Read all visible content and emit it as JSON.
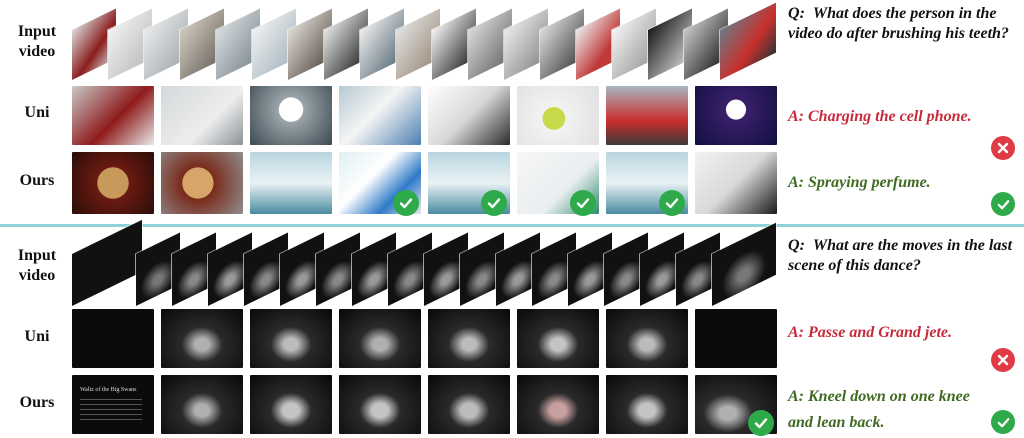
{
  "labels": {
    "input": "Input\nvideo",
    "uni": "Uni",
    "ours": "Ours"
  },
  "example1": {
    "question_prefix": "Q",
    "question": "What does the person in the video do after brushing his teeth?",
    "uni_answer": "A: Charging the cell phone.",
    "ours_answer": "A: Spraying perfume."
  },
  "example2": {
    "question_prefix": "Q",
    "question": "What are the moves in the last scene of this dance?",
    "uni_answer": "A: Passe and Grand jete.",
    "ours_answer": "A: Kneel down on one knee and lean back."
  },
  "frame_text": {
    "title_card": "Waltz of the Big Swans"
  },
  "colors": {
    "wrong": "#e03a45",
    "correct": "#2faa4a",
    "divider": "#8fd3d8"
  }
}
